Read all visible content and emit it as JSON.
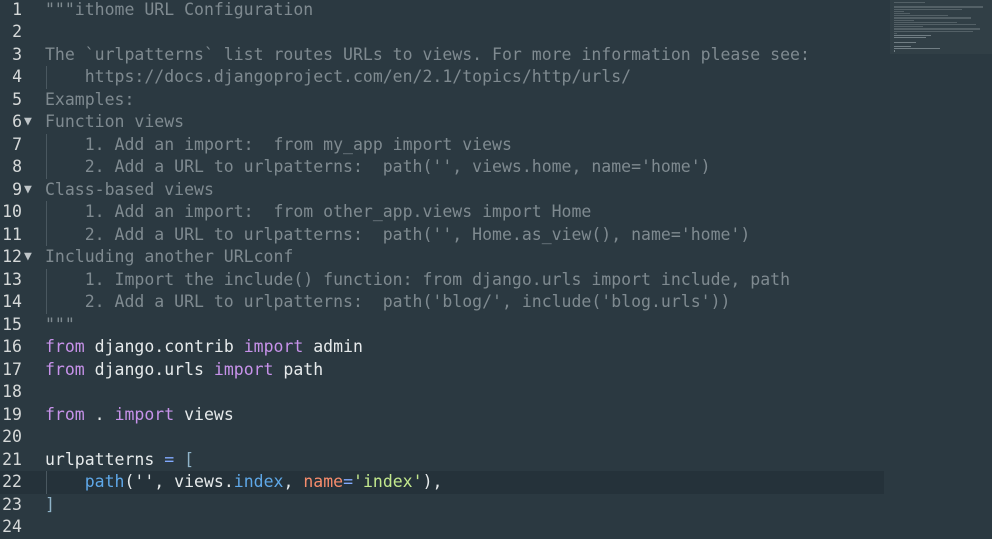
{
  "editor": {
    "current_line": 22,
    "lines": [
      {
        "n": "1",
        "segments": [
          {
            "t": "\"\"\"ithome URL Configuration",
            "c": "cmt"
          }
        ]
      },
      {
        "n": "2",
        "segments": []
      },
      {
        "n": "3",
        "segments": [
          {
            "t": "The `urlpatterns` list routes URLs to views. For more information please see:",
            "c": "cmt"
          }
        ]
      },
      {
        "n": "4",
        "segments": [
          {
            "t": "    https://docs.djangoproject.com/en/2.1/topics/http/urls/",
            "c": "cmt"
          }
        ]
      },
      {
        "n": "5",
        "segments": [
          {
            "t": "Examples:",
            "c": "cmt"
          }
        ]
      },
      {
        "n": "6",
        "fold": true,
        "segments": [
          {
            "t": "Function views",
            "c": "cmt"
          }
        ]
      },
      {
        "n": "7",
        "segments": [
          {
            "t": "    1. Add an import:  from my_app import views",
            "c": "cmt"
          }
        ]
      },
      {
        "n": "8",
        "segments": [
          {
            "t": "    2. Add a URL to urlpatterns:  path('', views.home, name='home')",
            "c": "cmt"
          }
        ]
      },
      {
        "n": "9",
        "fold": true,
        "segments": [
          {
            "t": "Class-based views",
            "c": "cmt"
          }
        ]
      },
      {
        "n": "10",
        "segments": [
          {
            "t": "    1. Add an import:  from other_app.views import Home",
            "c": "cmt"
          }
        ]
      },
      {
        "n": "11",
        "segments": [
          {
            "t": "    2. Add a URL to urlpatterns:  path('', Home.as_view(), name='home')",
            "c": "cmt"
          }
        ]
      },
      {
        "n": "12",
        "fold": true,
        "segments": [
          {
            "t": "Including another URLconf",
            "c": "cmt"
          }
        ]
      },
      {
        "n": "13",
        "segments": [
          {
            "t": "    1. Import the include() function: from django.urls import include, path",
            "c": "cmt"
          }
        ]
      },
      {
        "n": "14",
        "segments": [
          {
            "t": "    2. Add a URL to urlpatterns:  path('blog/', include('blog.urls'))",
            "c": "cmt"
          }
        ]
      },
      {
        "n": "15",
        "segments": [
          {
            "t": "\"\"\"",
            "c": "cmt"
          }
        ]
      },
      {
        "n": "16",
        "segments": [
          {
            "t": "from",
            "c": "kw"
          },
          {
            "t": " django.contrib ",
            "c": "plain"
          },
          {
            "t": "import",
            "c": "kw"
          },
          {
            "t": " admin",
            "c": "plain"
          }
        ]
      },
      {
        "n": "17",
        "segments": [
          {
            "t": "from",
            "c": "kw"
          },
          {
            "t": " django.urls ",
            "c": "plain"
          },
          {
            "t": "import",
            "c": "kw"
          },
          {
            "t": " path",
            "c": "plain"
          }
        ]
      },
      {
        "n": "18",
        "segments": []
      },
      {
        "n": "19",
        "segments": [
          {
            "t": "from",
            "c": "kw"
          },
          {
            "t": " . ",
            "c": "plain"
          },
          {
            "t": "import",
            "c": "kw"
          },
          {
            "t": " views",
            "c": "plain"
          }
        ]
      },
      {
        "n": "20",
        "segments": []
      },
      {
        "n": "21",
        "segments": [
          {
            "t": "urlpatterns ",
            "c": "plain"
          },
          {
            "t": "=",
            "c": "op"
          },
          {
            "t": " [",
            "c": "brk"
          }
        ]
      },
      {
        "n": "22",
        "segments": [
          {
            "t": "    ",
            "c": "plain"
          },
          {
            "t": "path",
            "c": "fn"
          },
          {
            "t": "('', ",
            "c": "plain"
          },
          {
            "t": "views",
            "c": "plain"
          },
          {
            "t": ".",
            "c": "plain"
          },
          {
            "t": "index",
            "c": "fn"
          },
          {
            "t": ", ",
            "c": "plain"
          },
          {
            "t": "name",
            "c": "prm"
          },
          {
            "t": "=",
            "c": "op"
          },
          {
            "t": "'index'",
            "c": "str"
          },
          {
            "t": "),",
            "c": "plain"
          }
        ]
      },
      {
        "n": "23",
        "segments": [
          {
            "t": "]",
            "c": "brk"
          }
        ]
      },
      {
        "n": "24",
        "segments": []
      }
    ],
    "fold_glyph": "▼"
  },
  "minimap": {
    "label": "minimap"
  }
}
